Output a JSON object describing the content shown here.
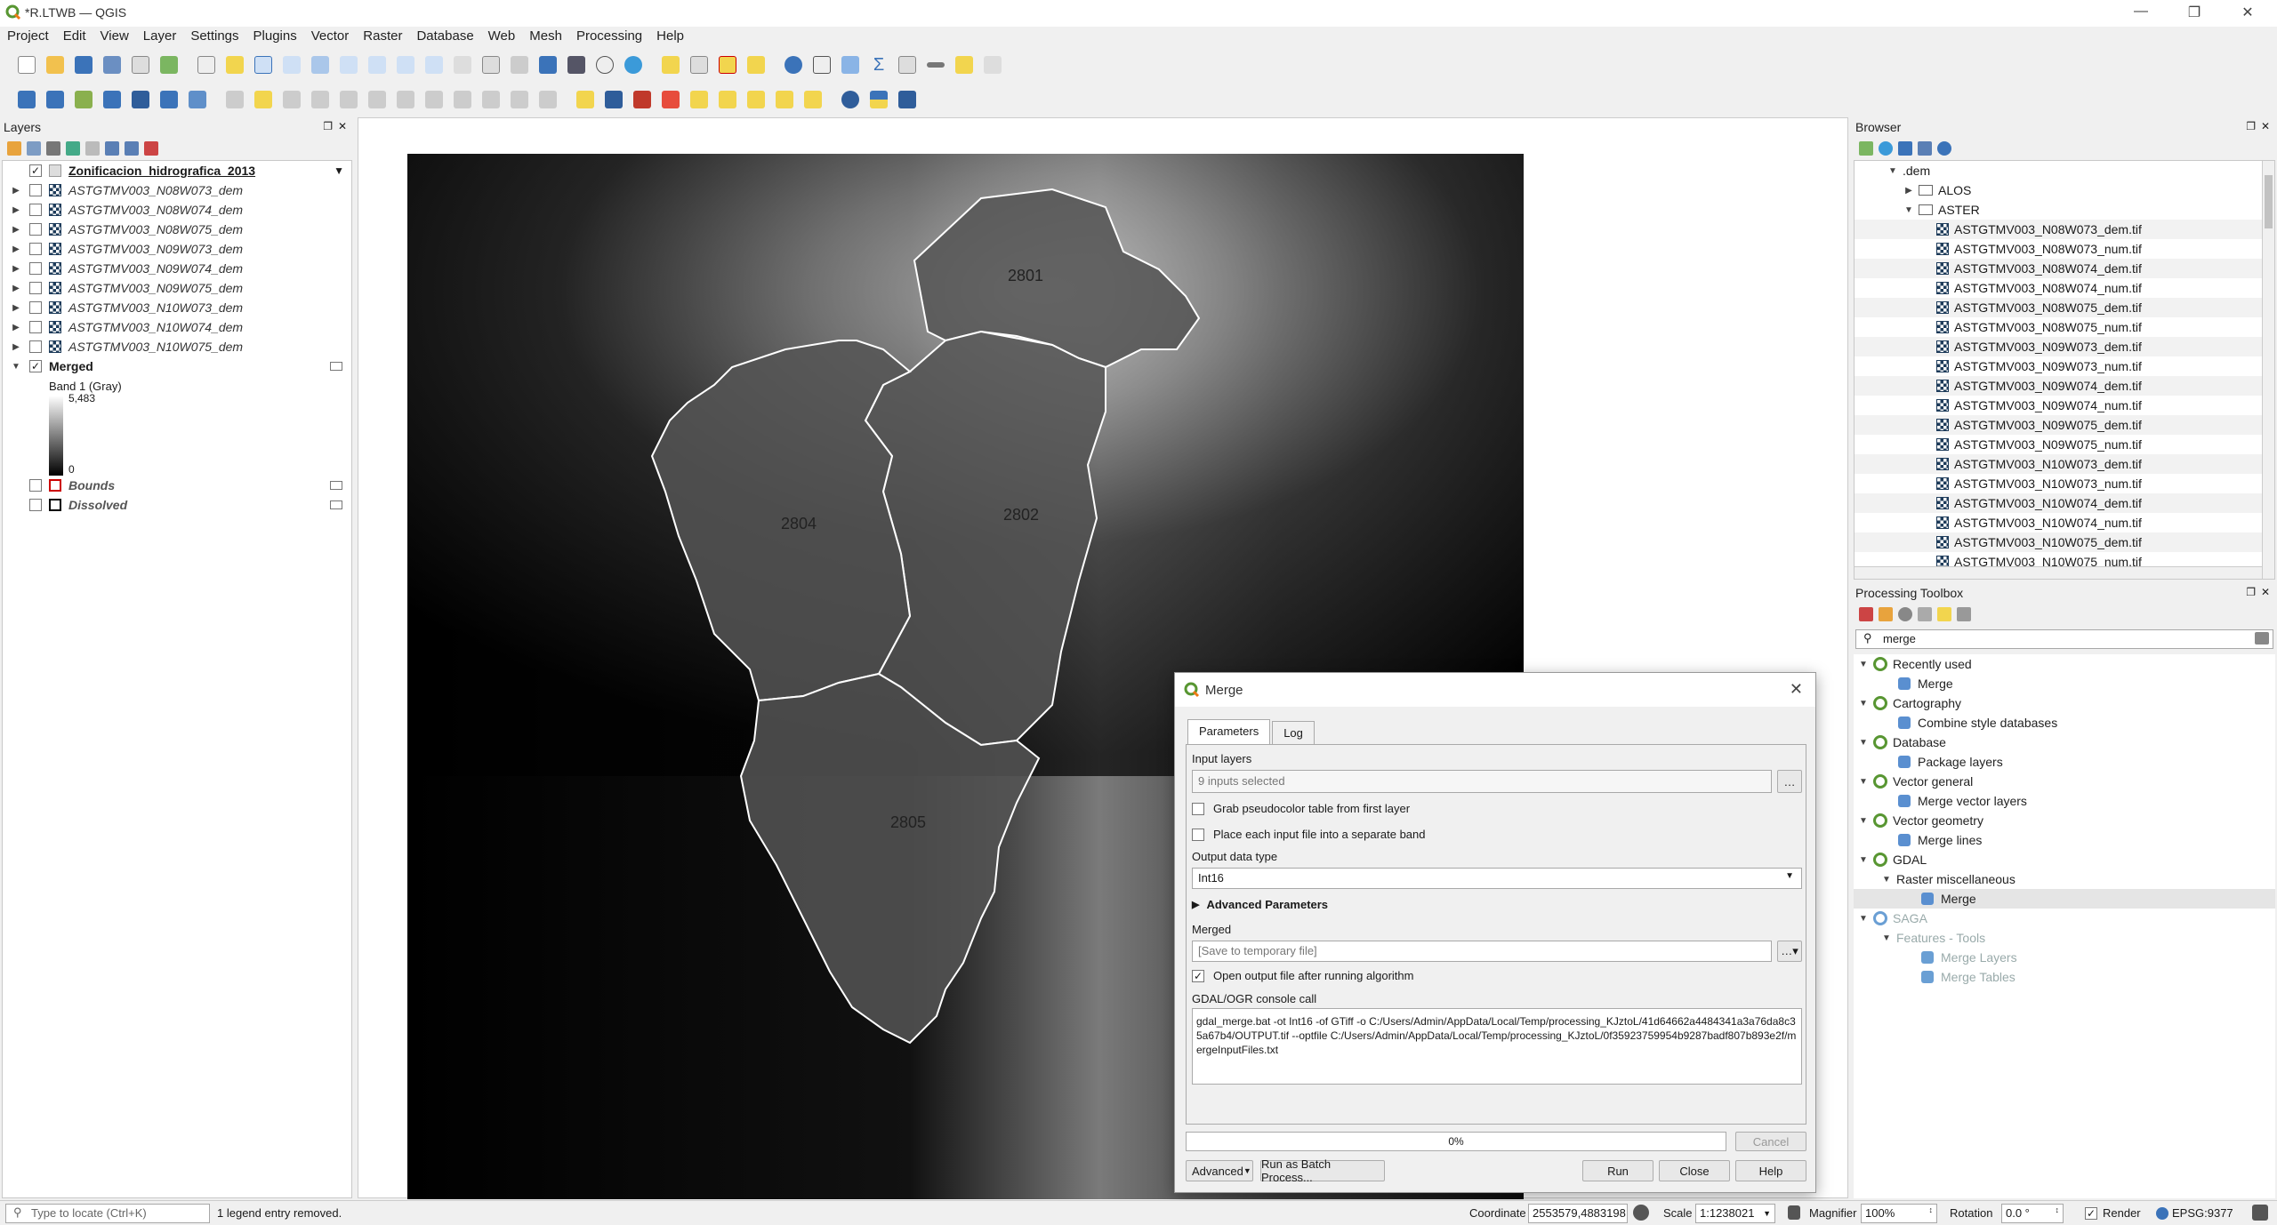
{
  "window": {
    "title": "*R.LTWB — QGIS"
  },
  "menu": [
    "Project",
    "Edit",
    "View",
    "Layer",
    "Settings",
    "Plugins",
    "Vector",
    "Raster",
    "Database",
    "Web",
    "Mesh",
    "Processing",
    "Help"
  ],
  "layers_panel": {
    "title": "Layers",
    "items": [
      {
        "name": "Zonificacion_hidrografica_2013",
        "checked": true,
        "style": "bold-underline"
      },
      {
        "name": "ASTGTMV003_N08W073_dem",
        "checked": false,
        "style": "italic"
      },
      {
        "name": "ASTGTMV003_N08W074_dem",
        "checked": false,
        "style": "italic"
      },
      {
        "name": "ASTGTMV003_N08W075_dem",
        "checked": false,
        "style": "italic"
      },
      {
        "name": "ASTGTMV003_N09W073_dem",
        "checked": false,
        "style": "italic"
      },
      {
        "name": "ASTGTMV003_N09W074_dem",
        "checked": false,
        "style": "italic"
      },
      {
        "name": "ASTGTMV003_N09W075_dem",
        "checked": false,
        "style": "italic"
      },
      {
        "name": "ASTGTMV003_N10W073_dem",
        "checked": false,
        "style": "italic"
      },
      {
        "name": "ASTGTMV003_N10W074_dem",
        "checked": false,
        "style": "italic"
      },
      {
        "name": "ASTGTMV003_N10W075_dem",
        "checked": false,
        "style": "italic"
      }
    ],
    "merged": {
      "name": "Merged",
      "band": "Band 1 (Gray)",
      "max": "5,483",
      "min": "0"
    },
    "bounds": "Bounds",
    "dissolved": "Dissolved"
  },
  "map": {
    "labels": [
      "2801",
      "2802",
      "2804",
      "2805"
    ]
  },
  "browser": {
    "title": "Browser",
    "root": ".dem",
    "folders": [
      "ALOS",
      "ASTER"
    ],
    "files": [
      "ASTGTMV003_N08W073_dem.tif",
      "ASTGTMV003_N08W073_num.tif",
      "ASTGTMV003_N08W074_dem.tif",
      "ASTGTMV003_N08W074_num.tif",
      "ASTGTMV003_N08W075_dem.tif",
      "ASTGTMV003_N08W075_num.tif",
      "ASTGTMV003_N09W073_dem.tif",
      "ASTGTMV003_N09W073_num.tif",
      "ASTGTMV003_N09W074_dem.tif",
      "ASTGTMV003_N09W074_num.tif",
      "ASTGTMV003_N09W075_dem.tif",
      "ASTGTMV003_N09W075_num.tif",
      "ASTGTMV003_N10W073_dem.tif",
      "ASTGTMV003_N10W073_num.tif",
      "ASTGTMV003_N10W074_dem.tif",
      "ASTGTMV003_N10W074_num.tif",
      "ASTGTMV003_N10W075_dem.tif",
      "ASTGTMV003_N10W075_num.tif"
    ]
  },
  "toolbox": {
    "title": "Processing Toolbox",
    "search": "merge",
    "groups": [
      {
        "name": "Recently used",
        "items": [
          "Merge"
        ]
      },
      {
        "name": "Cartography",
        "items": [
          "Combine style databases"
        ]
      },
      {
        "name": "Database",
        "items": [
          "Package layers"
        ]
      },
      {
        "name": "Vector general",
        "items": [
          "Merge vector layers"
        ]
      },
      {
        "name": "Vector geometry",
        "items": [
          "Merge lines"
        ]
      },
      {
        "name": "GDAL",
        "sub": "Raster miscellaneous",
        "items": [
          "Merge"
        ]
      },
      {
        "name": "SAGA",
        "sub": "Features - Tools",
        "items": [
          "Merge Layers",
          "Merge Tables"
        ]
      }
    ]
  },
  "dialog": {
    "title": "Merge",
    "tabs": [
      "Parameters",
      "Log"
    ],
    "input_layers_label": "Input layers",
    "input_layers_value": "9 inputs selected",
    "pseudocolor": "Grab pseudocolor table from first layer",
    "separate_band": "Place each input file into a separate band",
    "output_type_label": "Output data type",
    "output_type": "Int16",
    "advanced": "Advanced Parameters",
    "merged_label": "Merged",
    "merged_placeholder": "[Save to temporary file]",
    "open_output": "Open output file after running algorithm",
    "console_label": "GDAL/OGR console call",
    "console": "gdal_merge.bat -ot Int16 -of GTiff -o C:/Users/Admin/AppData/Local/Temp/processing_KJztoL/41d64662a4484341a3a76da8c35a67b4/OUTPUT.tif --optfile C:/Users/Admin/AppData/Local/Temp/processing_KJztoL/0f35923759954b9287badf807b893e2f/mergeInputFiles.txt",
    "progress": "0%",
    "cancel": "Cancel",
    "advanced_btn": "Advanced",
    "batch": "Run as Batch Process...",
    "run": "Run",
    "close": "Close",
    "help": "Help"
  },
  "status": {
    "locate": "Type to locate (Ctrl+K)",
    "message": "1 legend entry removed.",
    "coordinate_label": "Coordinate",
    "coordinate": "2553579,4883198",
    "scale_label": "Scale",
    "scale": "1:1238021",
    "magnifier_label": "Magnifier",
    "magnifier": "100%",
    "rotation_label": "Rotation",
    "rotation": "0.0 °",
    "render": "Render",
    "crs": "EPSG:9377"
  }
}
